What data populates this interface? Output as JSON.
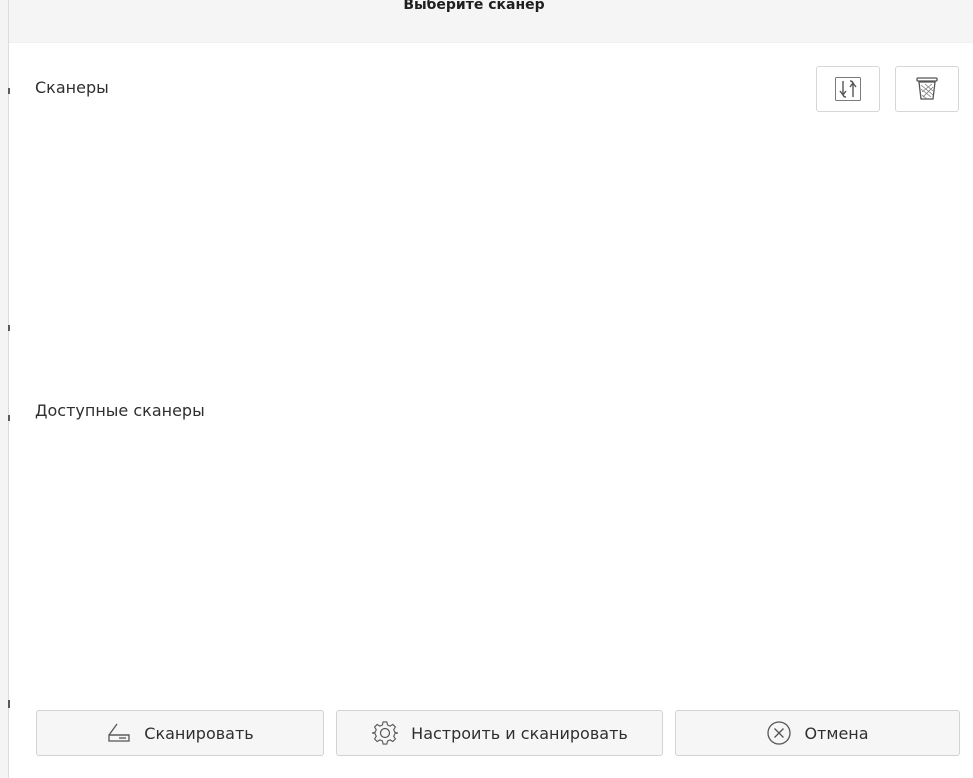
{
  "window": {
    "title": "Выберите сканер"
  },
  "sections": {
    "scanners_label": "Сканеры",
    "available_label": "Доступные сканеры"
  },
  "toolbar": {
    "refresh_icon": "refresh-icon",
    "delete_icon": "trash-icon"
  },
  "buttons": {
    "scan_label": "Сканировать",
    "configure_label": "Настроить и сканировать",
    "cancel_label": "Отмена"
  },
  "colors": {
    "titlebar_bg": "#f5f5f5",
    "button_bg": "#f6f6f6",
    "border": "#d3d3d3"
  }
}
